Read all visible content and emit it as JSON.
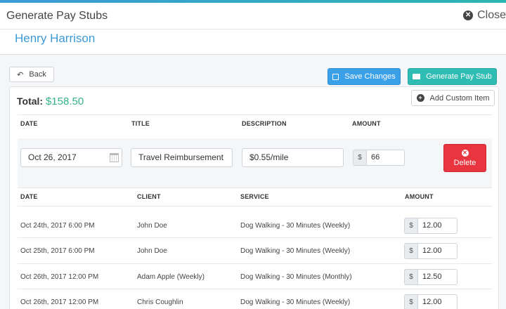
{
  "modal": {
    "title": "Generate Pay Stubs",
    "close_label": "Close"
  },
  "person": {
    "name": "Henry Harrison"
  },
  "toolbar": {
    "back_label": "Back",
    "save_label": "Save Changes",
    "generate_label": "Generate Pay Stub"
  },
  "summary": {
    "total_label": "Total:",
    "total_value": "$158.50",
    "add_custom_label": "Add Custom Item"
  },
  "custom_table": {
    "headers": [
      "DATE",
      "TITLE",
      "DESCRIPTION",
      "AMOUNT"
    ],
    "row": {
      "date": "Oct 26, 2017",
      "title": "Travel Reimbursement",
      "description": "$0.55/mile",
      "currency": "$",
      "amount": "66",
      "delete_label": "Delete"
    }
  },
  "items_table": {
    "headers": [
      "DATE",
      "CLIENT",
      "SERVICE",
      "AMOUNT"
    ],
    "rows": [
      {
        "date": "Oct 24th, 2017 6:00 PM",
        "client": "John Doe",
        "service": "Dog Walking - 30 Minutes (Weekly)",
        "currency": "$",
        "amount": "12.00"
      },
      {
        "date": "Oct 25th, 2017 6:00 PM",
        "client": "John Doe",
        "service": "Dog Walking - 30 Minutes (Weekly)",
        "currency": "$",
        "amount": "12.00"
      },
      {
        "date": "Oct 26th, 2017 12:00 PM",
        "client": "Adam Apple (Weekly)",
        "service": "Dog Walking - 30 Minutes (Monthly)",
        "currency": "$",
        "amount": "12.50"
      },
      {
        "date": "Oct 26th, 2017 12:00 PM",
        "client": "Chris Coughlin",
        "service": "Dog Walking - 30 Minutes (Weekly)",
        "currency": "$",
        "amount": "12.00"
      }
    ]
  },
  "colors": {
    "accent_blue": "#3d9ad6",
    "save_button": "#3aa0e8",
    "generate_button": "#2fbcb3",
    "delete_button": "#e8353f",
    "total_green": "#34b38a"
  }
}
